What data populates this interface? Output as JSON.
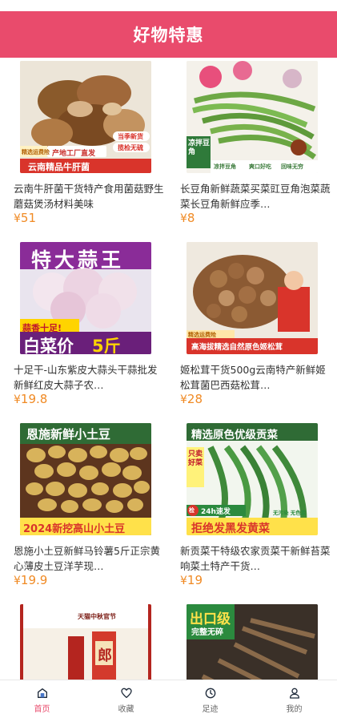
{
  "header": {
    "title": "好物特惠"
  },
  "products": [
    {
      "title": "云南牛肝菌干货特产食用菌菇野生蘑菇煲汤材料美味",
      "price": "51",
      "image": {
        "name": "porcini-product-image",
        "banner": "云南精品牛肝菌",
        "tag1": "产地工厂直发",
        "badge1": "当季新货",
        "badge2": "揽检无硫",
        "corner": "精选运费险"
      }
    },
    {
      "title": "长豆角新鲜蔬菜买菜豇豆角泡菜蔬菜长豆角新鲜应季…",
      "price": "8",
      "image": {
        "name": "long-bean-product-image",
        "side": "凉拌豆角",
        "b1": "凉拌豆角",
        "b2": "爽口好吃",
        "b3": "回味无穷"
      }
    },
    {
      "title": "十足干-山东紫皮大蒜头干蒜批发新鲜红皮大蒜子农…",
      "price": "19.8",
      "image": {
        "name": "garlic-product-image",
        "headline": "特大蒜王",
        "tag": "蒜香十足!",
        "banner": "白菜价",
        "num": "5斤"
      }
    },
    {
      "title": "姬松茸干货500g云南特产新鲜姬松茸菌巴西菇松茸…",
      "price": "28",
      "image": {
        "name": "agaricus-product-image",
        "banner": "高海拔精选自然原色姬松茸",
        "corner": "精选运费险"
      }
    },
    {
      "title": "恩施小土豆新鲜马铃薯5斤正宗黄心薄皮土豆洋芋现…",
      "price": "19.9",
      "image": {
        "name": "potato-product-image",
        "headline": "恩施新鲜小土豆",
        "banner": "2024新挖高山小土豆"
      }
    },
    {
      "title": "新贡菜干特级农家贡菜干新鲜苔菜响菜土特产干货…",
      "price": "19",
      "image": {
        "name": "gongcai-product-image",
        "headline": "精选原色优级贡菜",
        "side": "只卖好菜",
        "ship": "24h速发",
        "tag": "无污染 无色素",
        "banner": "拒绝发黑发黄菜",
        "badge": "检"
      }
    },
    {
      "title": "",
      "price": "",
      "image": {
        "name": "liquor-product-image",
        "label": "郎",
        "top": "天猫中秋官节"
      }
    },
    {
      "title": "",
      "price": "",
      "image": {
        "name": "dried-mushroom-product-image",
        "headline": "出口级",
        "sub": "完整无碎"
      }
    }
  ],
  "tabbar": {
    "items": [
      {
        "label": "首页",
        "icon": "home-icon",
        "active": true
      },
      {
        "label": "收藏",
        "icon": "heart-icon",
        "active": false
      },
      {
        "label": "足迹",
        "icon": "clock-icon",
        "active": false
      },
      {
        "label": "我的",
        "icon": "user-icon",
        "active": false
      }
    ]
  },
  "currency": "¥",
  "colors": {
    "accent": "#e94b6c",
    "price": "#f08a24"
  }
}
